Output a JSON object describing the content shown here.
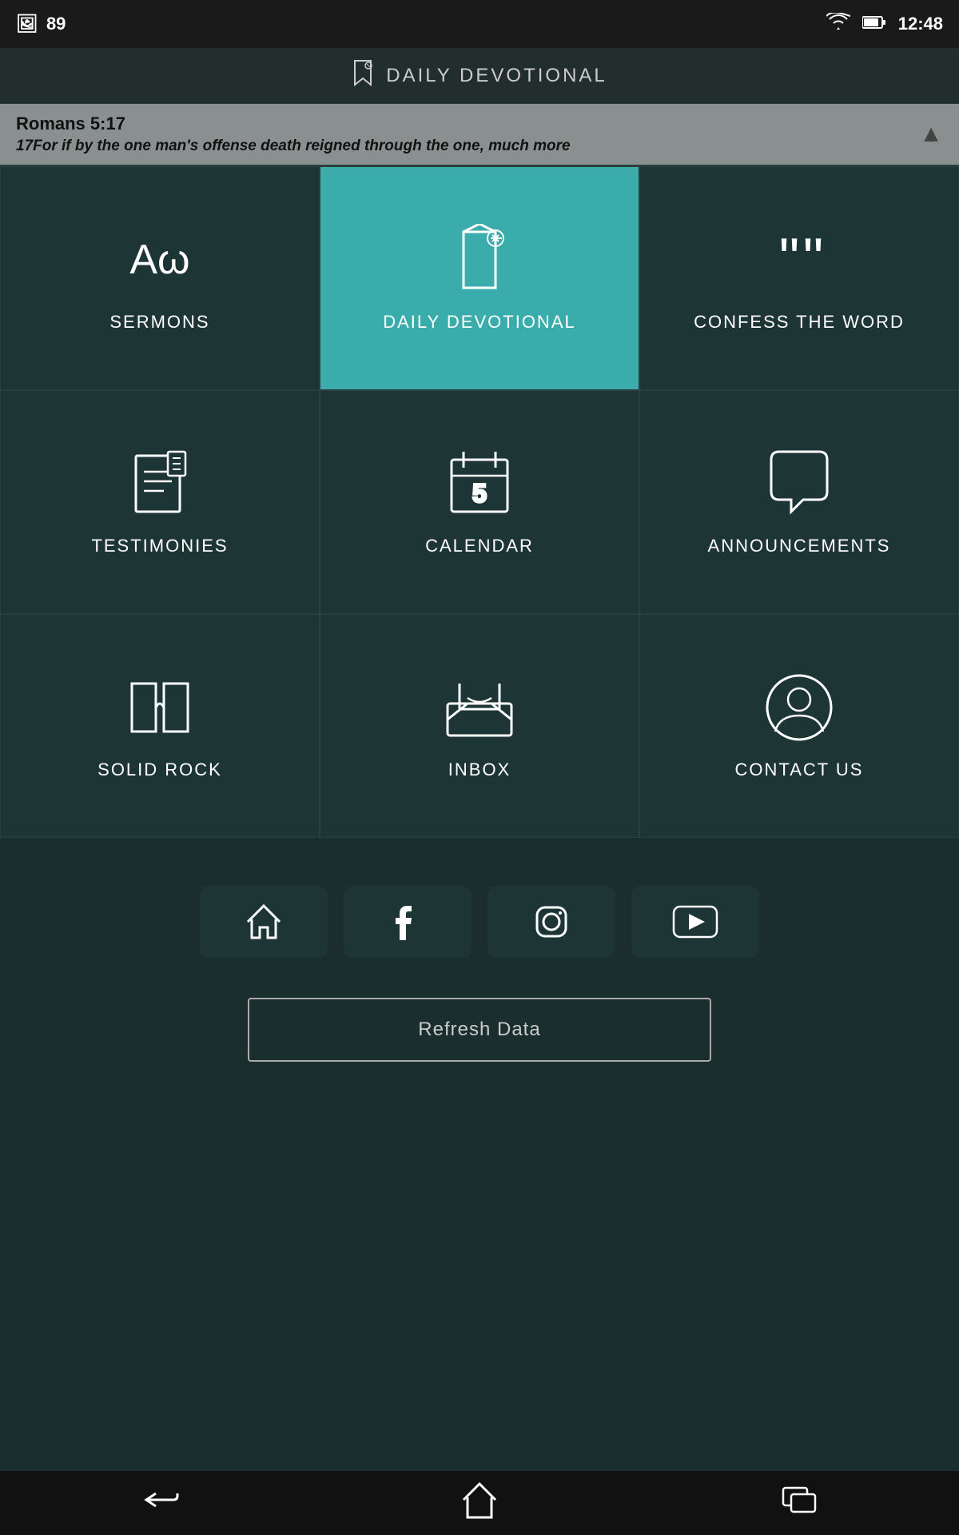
{
  "statusBar": {
    "notifications": "89",
    "time": "12:48",
    "wifiIcon": "wifi",
    "batteryIcon": "battery"
  },
  "header": {
    "title": "DAILY DEVOTIONAL",
    "bookmarkIcon": "🔖"
  },
  "scripture": {
    "reference": "Romans 5:17",
    "text": "17For if by the one man's offense death reigned through the one, much more"
  },
  "gridItems": [
    {
      "id": "sermons",
      "label": "SERMONS",
      "icon": "alpha-omega",
      "active": false
    },
    {
      "id": "daily-devotional",
      "label": "DAILY DEVOTIONAL",
      "icon": "bookmark-star",
      "active": true
    },
    {
      "id": "confess-the-word",
      "label": "CONFESS THE WORD",
      "icon": "quote",
      "active": false
    },
    {
      "id": "testimonies",
      "label": "TESTIMONIES",
      "icon": "document-bookmark",
      "active": false
    },
    {
      "id": "calendar",
      "label": "CALENDAR",
      "icon": "calendar-5",
      "active": false
    },
    {
      "id": "announcements",
      "label": "ANNOUNCEMENTS",
      "icon": "chat-bubble",
      "active": false
    },
    {
      "id": "solid-rock",
      "label": "SOLID ROCK",
      "icon": "open-book",
      "active": false
    },
    {
      "id": "inbox",
      "label": "INBOX",
      "icon": "inbox-tray",
      "active": false
    },
    {
      "id": "contact-us",
      "label": "CONTACT US",
      "icon": "user-circle",
      "active": false
    }
  ],
  "socialButtons": [
    {
      "id": "home",
      "icon": "🏠"
    },
    {
      "id": "facebook",
      "icon": "f"
    },
    {
      "id": "instagram",
      "icon": "📷"
    },
    {
      "id": "youtube",
      "icon": "▶"
    }
  ],
  "refreshButton": {
    "label": "Refresh Data"
  },
  "navBar": {
    "back": "←",
    "home": "⌂",
    "recents": "▭"
  }
}
